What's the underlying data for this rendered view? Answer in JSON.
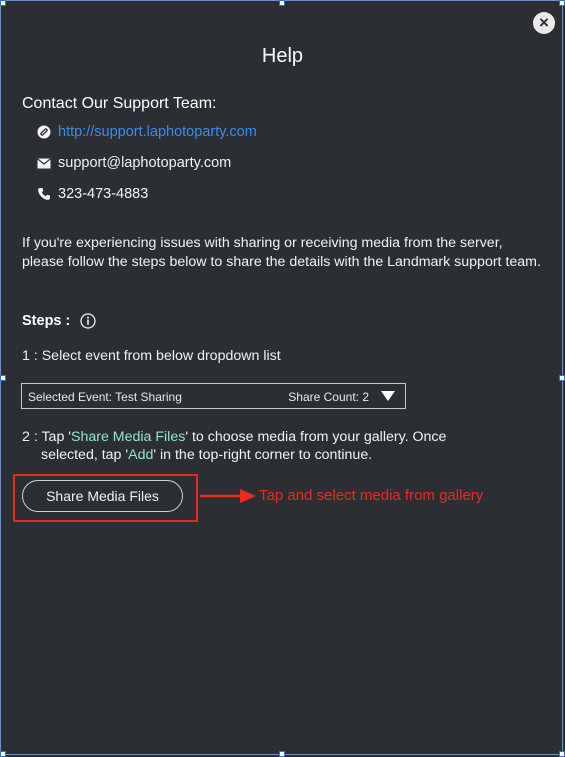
{
  "dialog": {
    "title": "Help",
    "close_label": "×"
  },
  "contact": {
    "heading": "Contact Our Support Team:",
    "website": "http://support.laphotoparty.com",
    "email": "support@laphotoparty.com",
    "phone": "323-473-4883"
  },
  "intro_text": "If you're experiencing issues with sharing or receiving media from the server, please follow the steps below to share the details with the Landmark support team.",
  "steps": {
    "label": "Steps :",
    "step1": "1 : Select event from below dropdown list",
    "dropdown": {
      "selected": "Selected Event: Test Sharing",
      "count": "Share Count: 2"
    },
    "step2": {
      "prefix": "2 : Tap '",
      "highlight1": "Share Media Files",
      "middle": "' to choose media from your gallery. Once",
      "line2_prefix": "selected, tap '",
      "highlight2": "Add",
      "line2_suffix": "' in the top-right corner to continue."
    }
  },
  "share_button": "Share Media Files",
  "annotation": {
    "text": "Tap and select media from gallery",
    "color": "#ec2a1f"
  },
  "colors": {
    "background": "#2b2f33",
    "link": "#3b8bf0",
    "highlight": "#8fe3d3"
  },
  "icons": [
    "close-icon",
    "link-icon",
    "mail-icon",
    "phone-icon",
    "info-icon",
    "dropdown-caret-icon",
    "arrow-right-icon"
  ]
}
